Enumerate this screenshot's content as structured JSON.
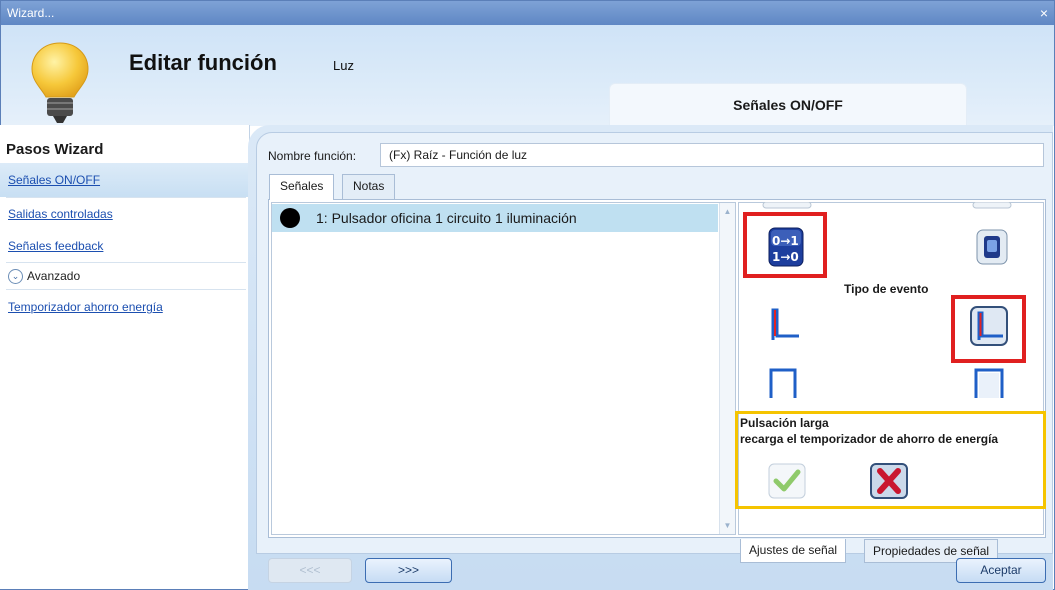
{
  "window": {
    "title": "Wizard...",
    "close": "×"
  },
  "header": {
    "title": "Editar función",
    "subtitle": "Luz",
    "step_tab": "Señales ON/OFF"
  },
  "sidebar": {
    "heading": "Pasos Wizard",
    "items": [
      {
        "label": "Señales ON/OFF",
        "active": true
      },
      {
        "label": "Salidas controladas"
      },
      {
        "label": "Señales feedback"
      }
    ],
    "advanced_label": "Avanzado",
    "advanced_items": [
      {
        "label": "Temporizador ahorro energía"
      }
    ]
  },
  "form": {
    "name_label": "Nombre función:",
    "name_value": "(Fx) Raíz - Función de luz"
  },
  "tabs": [
    {
      "label": "Señales"
    },
    {
      "label": "Notas"
    }
  ],
  "signals": [
    {
      "label": "1: Pulsador oficina 1 circuito 1 iluminación"
    }
  ],
  "settings": {
    "event_type_label": "Tipo de evento",
    "long_press_label": "Pulsación larga",
    "long_press_desc": "recarga el temporizador de ahorro de energía"
  },
  "bottom_tabs": [
    {
      "label": "Ajustes de señal"
    },
    {
      "label": "Propiedades de señal"
    }
  ],
  "nav": {
    "prev": "<<<",
    "next": ">>>",
    "accept": "Aceptar"
  },
  "colors": {
    "highlight_red": "#e02020",
    "highlight_yellow": "#f5c400",
    "accent_blue": "#3c6db2"
  }
}
